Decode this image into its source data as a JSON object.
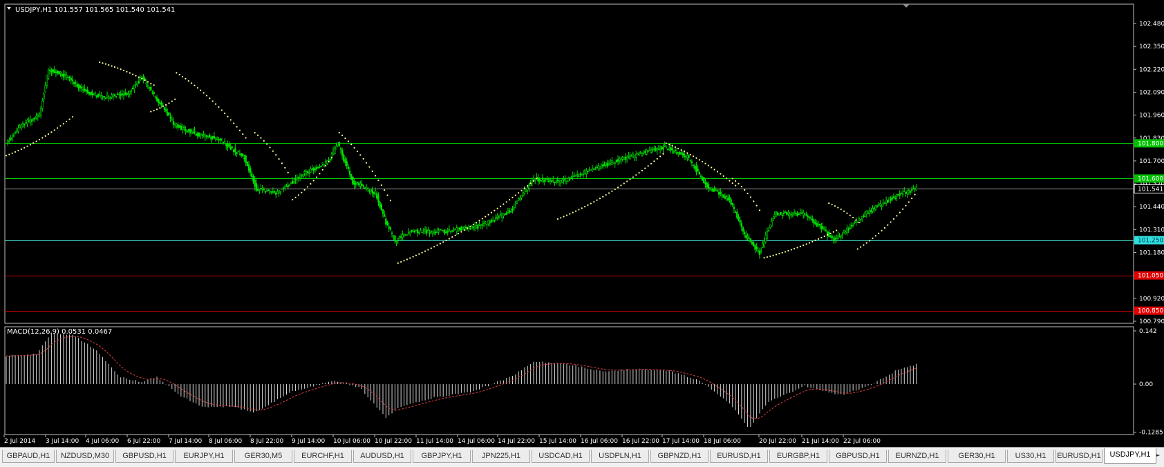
{
  "window": {
    "header": "USDJPY,H1  101.557 101.565 101.540 101.541",
    "collapse_icon": "triangle-down-icon"
  },
  "colors": {
    "background": "#000000",
    "frame": "#c0c0c0",
    "bull_candle": "#00e000",
    "psar": "#ffff99",
    "green_line": "#00c800",
    "cyan_line": "#40e0d0",
    "red_line": "#d00000",
    "bid_line": "#a0a0a0",
    "macd_hist": "#d8d8d8",
    "macd_signal": "#e04040"
  },
  "price_axis": {
    "ticks": [
      "102.480",
      "102.350",
      "102.220",
      "102.090",
      "101.960",
      "101.830",
      "101.700",
      "101.570",
      "101.440",
      "101.310",
      "101.180",
      "101.050",
      "100.920",
      "100.790"
    ],
    "range": [
      100.79,
      102.48
    ]
  },
  "price_labels": [
    {
      "text": "101.800",
      "price": 101.8,
      "kind": "green"
    },
    {
      "text": "101.600",
      "price": 101.6,
      "kind": "green"
    },
    {
      "text": "101.541",
      "price": 101.541,
      "kind": "bid"
    },
    {
      "text": "101.250",
      "price": 101.25,
      "kind": "cyan"
    },
    {
      "text": "101.050",
      "price": 101.05,
      "kind": "red"
    },
    {
      "text": "100.850",
      "price": 100.85,
      "kind": "red"
    }
  ],
  "time_axis": {
    "labels": [
      "2 Jul 2014",
      "3 Jul 14:00",
      "4 Jul 06:00",
      "6 Jul 22:00",
      "7 Jul 14:00",
      "8 Jul 06:00",
      "8 Jul 22:00",
      "9 Jul 14:00",
      "10 Jul 06:00",
      "10 Jul 22:00",
      "11 Jul 14:00",
      "14 Jul 06:00",
      "14 Jul 22:00",
      "15 Jul 14:00",
      "16 Jul 06:00",
      "16 Jul 22:00",
      "17 Jul 14:00",
      "18 Jul 06:00",
      "20 Jul 22:00",
      "21 Jul 14:00",
      "22 Jul 06:00"
    ]
  },
  "macd": {
    "title": "MACD(12,26,9) 0.0531 0.0467",
    "ticks": [
      "0.142",
      "0.00",
      "-0.1285"
    ],
    "range": [
      -0.1285,
      0.142
    ]
  },
  "chart_data": {
    "type": "candlestick",
    "symbol": "USDJPY",
    "timeframe": "H1",
    "last": {
      "open": 101.557,
      "high": 101.565,
      "low": 101.54,
      "close": 101.541
    },
    "ylim": [
      100.79,
      102.48
    ],
    "horizontal_levels": [
      101.8,
      101.6,
      101.25,
      101.05,
      100.85
    ],
    "price_path": [
      {
        "i": 0,
        "p": 101.8
      },
      {
        "i": 10,
        "p": 101.9
      },
      {
        "i": 22,
        "p": 101.96
      },
      {
        "i": 28,
        "p": 102.22
      },
      {
        "i": 40,
        "p": 102.18
      },
      {
        "i": 52,
        "p": 102.1
      },
      {
        "i": 64,
        "p": 102.06
      },
      {
        "i": 80,
        "p": 102.08
      },
      {
        "i": 90,
        "p": 102.17
      },
      {
        "i": 100,
        "p": 102.05
      },
      {
        "i": 112,
        "p": 101.9
      },
      {
        "i": 128,
        "p": 101.85
      },
      {
        "i": 142,
        "p": 101.82
      },
      {
        "i": 158,
        "p": 101.72
      },
      {
        "i": 166,
        "p": 101.54
      },
      {
        "i": 180,
        "p": 101.52
      },
      {
        "i": 196,
        "p": 101.62
      },
      {
        "i": 214,
        "p": 101.7
      },
      {
        "i": 220,
        "p": 101.8
      },
      {
        "i": 230,
        "p": 101.58
      },
      {
        "i": 245,
        "p": 101.52
      },
      {
        "i": 252,
        "p": 101.35
      },
      {
        "i": 258,
        "p": 101.25
      },
      {
        "i": 268,
        "p": 101.3
      },
      {
        "i": 290,
        "p": 101.3
      },
      {
        "i": 315,
        "p": 101.33
      },
      {
        "i": 335,
        "p": 101.42
      },
      {
        "i": 350,
        "p": 101.6
      },
      {
        "i": 368,
        "p": 101.58
      },
      {
        "i": 385,
        "p": 101.64
      },
      {
        "i": 405,
        "p": 101.7
      },
      {
        "i": 425,
        "p": 101.75
      },
      {
        "i": 437,
        "p": 101.78
      },
      {
        "i": 452,
        "p": 101.72
      },
      {
        "i": 466,
        "p": 101.55
      },
      {
        "i": 480,
        "p": 101.48
      },
      {
        "i": 490,
        "p": 101.28
      },
      {
        "i": 500,
        "p": 101.18
      },
      {
        "i": 510,
        "p": 101.4
      },
      {
        "i": 530,
        "p": 101.4
      },
      {
        "i": 550,
        "p": 101.25
      },
      {
        "i": 570,
        "p": 101.4
      },
      {
        "i": 590,
        "p": 101.5
      },
      {
        "i": 604,
        "p": 101.545
      }
    ],
    "psar_segments": [
      {
        "from": {
          "i": 0,
          "p": 101.73
        },
        "to": {
          "i": 44,
          "p": 101.95
        }
      },
      {
        "from": {
          "i": 62,
          "p": 102.26
        },
        "to": {
          "i": 98,
          "p": 102.13
        }
      },
      {
        "from": {
          "i": 96,
          "p": 101.98
        },
        "to": {
          "i": 112,
          "p": 102.05
        }
      },
      {
        "from": {
          "i": 113,
          "p": 102.2
        },
        "to": {
          "i": 160,
          "p": 101.82
        }
      },
      {
        "from": {
          "i": 165,
          "p": 101.86
        },
        "to": {
          "i": 188,
          "p": 101.62
        }
      },
      {
        "from": {
          "i": 190,
          "p": 101.48
        },
        "to": {
          "i": 216,
          "p": 101.72
        }
      },
      {
        "from": {
          "i": 221,
          "p": 101.86
        },
        "to": {
          "i": 256,
          "p": 101.46
        }
      },
      {
        "from": {
          "i": 260,
          "p": 101.12
        },
        "to": {
          "i": 352,
          "p": 101.6
        }
      },
      {
        "from": {
          "i": 366,
          "p": 101.37
        },
        "to": {
          "i": 436,
          "p": 101.74
        }
      },
      {
        "from": {
          "i": 438,
          "p": 101.8
        },
        "to": {
          "i": 484,
          "p": 101.56
        }
      },
      {
        "from": {
          "i": 482,
          "p": 101.6
        },
        "to": {
          "i": 500,
          "p": 101.42
        }
      },
      {
        "from": {
          "i": 503,
          "p": 101.15
        },
        "to": {
          "i": 552,
          "p": 101.31
        }
      },
      {
        "from": {
          "i": 546,
          "p": 101.46
        },
        "to": {
          "i": 566,
          "p": 101.35
        }
      },
      {
        "from": {
          "i": 565,
          "p": 101.2
        },
        "to": {
          "i": 604,
          "p": 101.52
        }
      }
    ],
    "macd_path": [
      {
        "i": 0,
        "v": 0.075
      },
      {
        "i": 20,
        "v": 0.08
      },
      {
        "i": 30,
        "v": 0.135
      },
      {
        "i": 45,
        "v": 0.13
      },
      {
        "i": 60,
        "v": 0.09
      },
      {
        "i": 75,
        "v": 0.02
      },
      {
        "i": 90,
        "v": 0.005
      },
      {
        "i": 100,
        "v": 0.02
      },
      {
        "i": 115,
        "v": -0.03
      },
      {
        "i": 130,
        "v": -0.06
      },
      {
        "i": 150,
        "v": -0.06
      },
      {
        "i": 165,
        "v": -0.075
      },
      {
        "i": 190,
        "v": -0.02
      },
      {
        "i": 218,
        "v": 0.01
      },
      {
        "i": 235,
        "v": -0.01
      },
      {
        "i": 252,
        "v": -0.09
      },
      {
        "i": 262,
        "v": -0.06
      },
      {
        "i": 285,
        "v": -0.035
      },
      {
        "i": 310,
        "v": -0.02
      },
      {
        "i": 335,
        "v": 0.02
      },
      {
        "i": 350,
        "v": 0.06
      },
      {
        "i": 370,
        "v": 0.055
      },
      {
        "i": 395,
        "v": 0.035
      },
      {
        "i": 420,
        "v": 0.04
      },
      {
        "i": 440,
        "v": 0.035
      },
      {
        "i": 460,
        "v": 0.01
      },
      {
        "i": 480,
        "v": -0.05
      },
      {
        "i": 493,
        "v": -0.12
      },
      {
        "i": 505,
        "v": -0.05
      },
      {
        "i": 530,
        "v": -0.005
      },
      {
        "i": 555,
        "v": -0.03
      },
      {
        "i": 575,
        "v": 0.0
      },
      {
        "i": 590,
        "v": 0.035
      },
      {
        "i": 604,
        "v": 0.053
      }
    ]
  },
  "tabs": [
    {
      "label": "GBPAUD,H1",
      "active": false
    },
    {
      "label": "NZDUSD,M30",
      "active": false
    },
    {
      "label": "GBPUSD,H1",
      "active": false
    },
    {
      "label": "EURJPY,H1",
      "active": false
    },
    {
      "label": "GER30,M5",
      "active": false
    },
    {
      "label": "EURCHF,H1",
      "active": false
    },
    {
      "label": "AUDUSD,H1",
      "active": false
    },
    {
      "label": "GBPJPY,H1",
      "active": false
    },
    {
      "label": "JPN225,H1",
      "active": false
    },
    {
      "label": "USDCAD,H1",
      "active": false
    },
    {
      "label": "USDPLN,H1",
      "active": false
    },
    {
      "label": "GBPNZD,H1",
      "active": false
    },
    {
      "label": "EURUSD,H1",
      "active": false
    },
    {
      "label": "EURGBP,H1",
      "active": false
    },
    {
      "label": "GBPUSD,H1",
      "active": false
    },
    {
      "label": "EURNZD,H1",
      "active": false
    },
    {
      "label": "GER30,H1",
      "active": false
    },
    {
      "label": "US30,H1",
      "active": false
    },
    {
      "label": "EURUSD,H1",
      "active": false
    },
    {
      "label": "USDJPY,H1",
      "active": true
    }
  ],
  "tab_scroll": {
    "left": "◄",
    "right": "►"
  }
}
